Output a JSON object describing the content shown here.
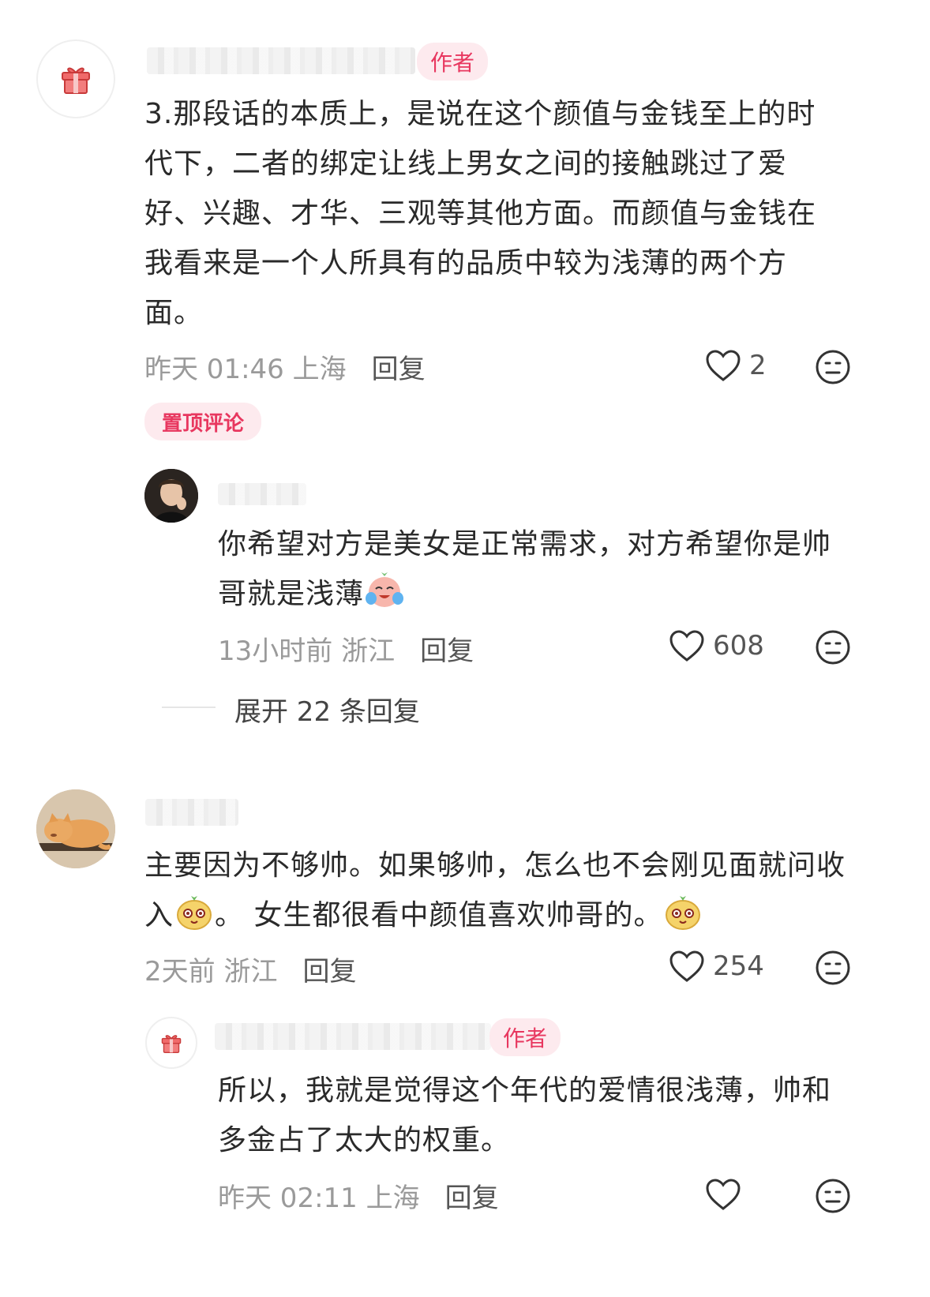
{
  "comments": [
    {
      "author_badge": "作者",
      "text": "3.那段话的本质上，是说在这个颜值与金钱至上的时代下，二者的绑定让线上男女之间的接触跳过了爱好、兴趣、才华、三观等其他方面。而颜值与金钱在我看来是一个人所具有的品质中较为浅薄的两个方面。",
      "meta": "昨天 01:46 上海",
      "reply_label": "回复",
      "likes": "2",
      "pinned_label": "置顶评论"
    },
    {
      "text": "你希望对方是美女是正常需求，对方希望你是帅哥就是浅薄",
      "meta": "13小时前 浙江",
      "reply_label": "回复",
      "likes": "608",
      "expand_label": "展开 22 条回复"
    },
    {
      "text_part1": "主要因为不够帅。如果够帅，怎么也不会刚见面就问收入",
      "text_part2": "。  女生都很看中颜值喜欢帅哥的。",
      "meta": "2天前 浙江",
      "reply_label": "回复",
      "likes": "254"
    },
    {
      "author_badge": "作者",
      "text": "所以，我就是觉得这个年代的爱情很浅薄，帅和多金占了太大的权重。",
      "meta": "昨天 02:11 上海",
      "reply_label": "回复"
    }
  ],
  "icons": {
    "avatar_gift": "gift-icon",
    "like": "heart-icon",
    "dislike": "meh-face-icon",
    "emoji_cry": "crying-laugh-emoji",
    "emoji_cute": "cute-bun-emoji"
  },
  "colors": {
    "accent": "#e8375f",
    "badge_bg": "#fdeaee",
    "meta": "#9a9a9a"
  }
}
